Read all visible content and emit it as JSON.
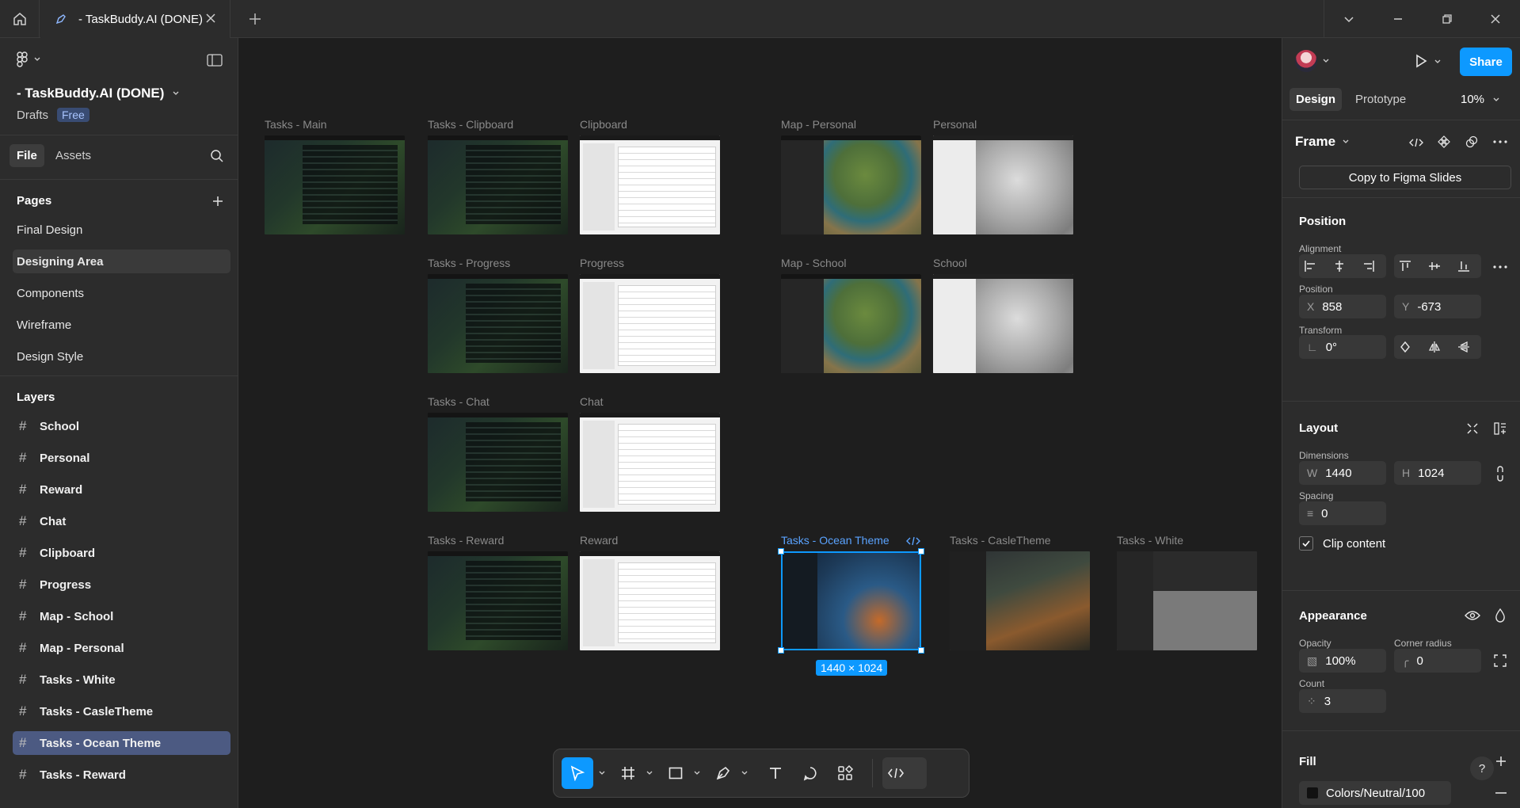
{
  "titlebar": {
    "tab_title": "- TaskBuddy.AI (DONE)"
  },
  "left": {
    "file_title": "- TaskBuddy.AI (DONE)",
    "drafts": "Drafts",
    "plan_badge": "Free",
    "tabs": {
      "file": "File",
      "assets": "Assets"
    },
    "pages_heading": "Pages",
    "pages": [
      "Final Design",
      "Designing Area",
      "Components",
      "Wireframe",
      "Design Style"
    ],
    "layers_heading": "Layers",
    "layers": [
      "School",
      "Personal",
      "Reward",
      "Chat",
      "Clipboard",
      "Progress",
      "Map - School",
      "Map - Personal",
      "Tasks - White",
      "Tasks - CasleTheme",
      "Tasks - Ocean Theme",
      "Tasks - Reward"
    ]
  },
  "canvas": {
    "frames": [
      {
        "label": "Tasks - Main",
        "style": "dark"
      },
      {
        "label": "Tasks - Clipboard",
        "style": "dark"
      },
      {
        "label": "Clipboard",
        "style": "white"
      },
      {
        "label": "Map - Personal",
        "style": "map"
      },
      {
        "label": "Personal",
        "style": "gray"
      },
      {
        "label": "Tasks - Progress",
        "style": "dark"
      },
      {
        "label": "Progress",
        "style": "white"
      },
      {
        "label": "Map - School",
        "style": "map"
      },
      {
        "label": "School",
        "style": "gray"
      },
      {
        "label": "Tasks - Chat",
        "style": "dark"
      },
      {
        "label": "Chat",
        "style": "white"
      },
      {
        "label": "Tasks - Reward",
        "style": "dark"
      },
      {
        "label": "Reward",
        "style": "white"
      },
      {
        "label": "Tasks - Ocean Theme",
        "style": "ocean"
      },
      {
        "label": "Tasks - CasleTheme",
        "style": "castle"
      },
      {
        "label": "Tasks - White",
        "style": "whitetheme"
      }
    ],
    "selection_size": "1440 × 1024"
  },
  "right": {
    "tabs": {
      "design": "Design",
      "prototype": "Prototype"
    },
    "zoom": "10%",
    "share": "Share",
    "frame_label": "Frame",
    "copy_slides": "Copy to Figma Slides",
    "position_heading": "Position",
    "alignment_label": "Alignment",
    "position_label": "Position",
    "x_prefix": "X",
    "x_value": "858",
    "y_prefix": "Y",
    "y_value": "-673",
    "transform_label": "Transform",
    "rotation": "0°",
    "layout_heading": "Layout",
    "dimensions_label": "Dimensions",
    "w_prefix": "W",
    "w_value": "1440",
    "h_prefix": "H",
    "h_value": "1024",
    "spacing_label": "Spacing",
    "spacing_value": "0",
    "clip_content": "Clip content",
    "appearance_heading": "Appearance",
    "opacity_label": "Opacity",
    "opacity_value": "100%",
    "corner_label": "Corner radius",
    "corner_value": "0",
    "count_label": "Count",
    "count_value": "3",
    "fill_heading": "Fill",
    "fill_value": "Colors/Neutral/100"
  },
  "colors": {
    "accent": "#0d99ff",
    "selection_layer": "#4c5a82",
    "panel": "#2c2c2c",
    "canvas": "#1e1e1e"
  }
}
